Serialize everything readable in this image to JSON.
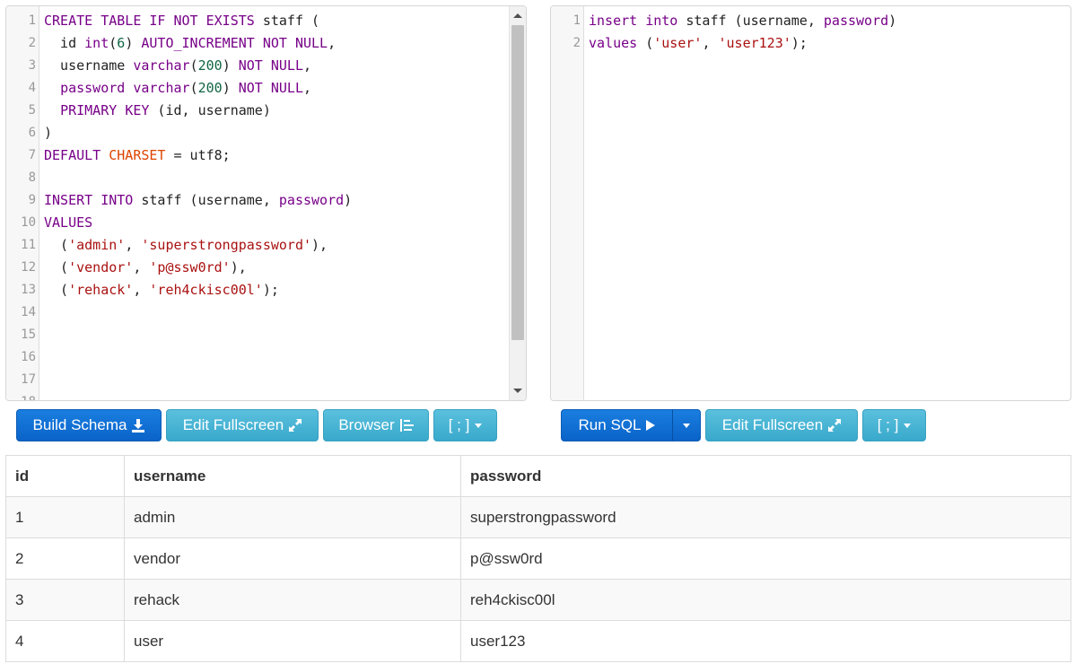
{
  "schema_editor": {
    "lines": [
      [
        {
          "t": "kw",
          "v": "CREATE"
        },
        {
          "t": "",
          "v": " "
        },
        {
          "t": "kw",
          "v": "TABLE"
        },
        {
          "t": "",
          "v": " "
        },
        {
          "t": "kw",
          "v": "IF"
        },
        {
          "t": "",
          "v": " "
        },
        {
          "t": "kw",
          "v": "NOT"
        },
        {
          "t": "",
          "v": " "
        },
        {
          "t": "kw",
          "v": "EXISTS"
        },
        {
          "t": "",
          "v": " staff ("
        }
      ],
      [
        {
          "t": "",
          "v": "  id "
        },
        {
          "t": "kw",
          "v": "int"
        },
        {
          "t": "",
          "v": "("
        },
        {
          "t": "num",
          "v": "6"
        },
        {
          "t": "",
          "v": ") "
        },
        {
          "t": "kw",
          "v": "AUTO_INCREMENT"
        },
        {
          "t": "",
          "v": " "
        },
        {
          "t": "kw",
          "v": "NOT"
        },
        {
          "t": "",
          "v": " "
        },
        {
          "t": "kw",
          "v": "NULL"
        },
        {
          "t": "",
          "v": ","
        }
      ],
      [
        {
          "t": "",
          "v": "  username "
        },
        {
          "t": "kw",
          "v": "varchar"
        },
        {
          "t": "",
          "v": "("
        },
        {
          "t": "num",
          "v": "200"
        },
        {
          "t": "",
          "v": ") "
        },
        {
          "t": "kw",
          "v": "NOT"
        },
        {
          "t": "",
          "v": " "
        },
        {
          "t": "kw",
          "v": "NULL"
        },
        {
          "t": "",
          "v": ","
        }
      ],
      [
        {
          "t": "",
          "v": "  "
        },
        {
          "t": "kw",
          "v": "password"
        },
        {
          "t": "",
          "v": " "
        },
        {
          "t": "kw",
          "v": "varchar"
        },
        {
          "t": "",
          "v": "("
        },
        {
          "t": "num",
          "v": "200"
        },
        {
          "t": "",
          "v": ") "
        },
        {
          "t": "kw",
          "v": "NOT"
        },
        {
          "t": "",
          "v": " "
        },
        {
          "t": "kw",
          "v": "NULL"
        },
        {
          "t": "",
          "v": ","
        }
      ],
      [
        {
          "t": "",
          "v": "  "
        },
        {
          "t": "kw",
          "v": "PRIMARY"
        },
        {
          "t": "",
          "v": " "
        },
        {
          "t": "kw",
          "v": "KEY"
        },
        {
          "t": "",
          "v": " (id, username)"
        }
      ],
      [
        {
          "t": "",
          "v": ")"
        }
      ],
      [
        {
          "t": "kw",
          "v": "DEFAULT"
        },
        {
          "t": "",
          "v": " "
        },
        {
          "t": "bi",
          "v": "CHARSET"
        },
        {
          "t": "",
          "v": " = utf8;"
        }
      ],
      [],
      [
        {
          "t": "kw",
          "v": "INSERT"
        },
        {
          "t": "",
          "v": " "
        },
        {
          "t": "kw",
          "v": "INTO"
        },
        {
          "t": "",
          "v": " staff (username, "
        },
        {
          "t": "kw",
          "v": "password"
        },
        {
          "t": "",
          "v": ")"
        }
      ],
      [
        {
          "t": "kw",
          "v": "VALUES"
        }
      ],
      [
        {
          "t": "",
          "v": "  ("
        },
        {
          "t": "str",
          "v": "'admin'"
        },
        {
          "t": "",
          "v": ", "
        },
        {
          "t": "str",
          "v": "'superstrongpassword'"
        },
        {
          "t": "",
          "v": "),"
        }
      ],
      [
        {
          "t": "",
          "v": "  ("
        },
        {
          "t": "str",
          "v": "'vendor'"
        },
        {
          "t": "",
          "v": ", "
        },
        {
          "t": "str",
          "v": "'p@ssw0rd'"
        },
        {
          "t": "",
          "v": "),"
        }
      ],
      [
        {
          "t": "",
          "v": "  ("
        },
        {
          "t": "str",
          "v": "'rehack'"
        },
        {
          "t": "",
          "v": ", "
        },
        {
          "t": "str",
          "v": "'reh4ckisc00l'"
        },
        {
          "t": "",
          "v": ");"
        }
      ],
      [],
      [],
      [],
      [],
      []
    ]
  },
  "query_editor": {
    "lines": [
      [
        {
          "t": "kw",
          "v": "insert"
        },
        {
          "t": "",
          "v": " "
        },
        {
          "t": "kw",
          "v": "into"
        },
        {
          "t": "",
          "v": " staff (username, "
        },
        {
          "t": "kw",
          "v": "password"
        },
        {
          "t": "",
          "v": ")"
        }
      ],
      [
        {
          "t": "kw",
          "v": "values"
        },
        {
          "t": "",
          "v": " ("
        },
        {
          "t": "str",
          "v": "'user'"
        },
        {
          "t": "",
          "v": ", "
        },
        {
          "t": "str",
          "v": "'user123'"
        },
        {
          "t": "",
          "v": ");"
        }
      ]
    ]
  },
  "schema_toolbar": {
    "build_schema": "Build Schema",
    "edit_fullscreen": "Edit Fullscreen",
    "browser": "Browser",
    "delimiter": "[ ; ]"
  },
  "query_toolbar": {
    "run_sql": "Run SQL",
    "edit_fullscreen": "Edit Fullscreen",
    "delimiter": "[ ; ]"
  },
  "results": {
    "columns": [
      "id",
      "username",
      "password"
    ],
    "rows": [
      [
        "1",
        "admin",
        "superstrongpassword"
      ],
      [
        "2",
        "vendor",
        "p@ssw0rd"
      ],
      [
        "3",
        "rehack",
        "reh4ckisc00l"
      ],
      [
        "4",
        "user",
        "user123"
      ]
    ]
  },
  "colors": {
    "keyword": "#770088",
    "number": "#116644",
    "string": "#aa1111",
    "builtin": "#dd4400",
    "primary_button": "#0a63c8",
    "info_button": "#46b8da"
  },
  "icons": {
    "build_schema": "download-icon",
    "edit_fullscreen": "expand-icon",
    "browser": "tree-icon",
    "run_sql": "play-icon",
    "dropdown": "caret-down-icon"
  }
}
